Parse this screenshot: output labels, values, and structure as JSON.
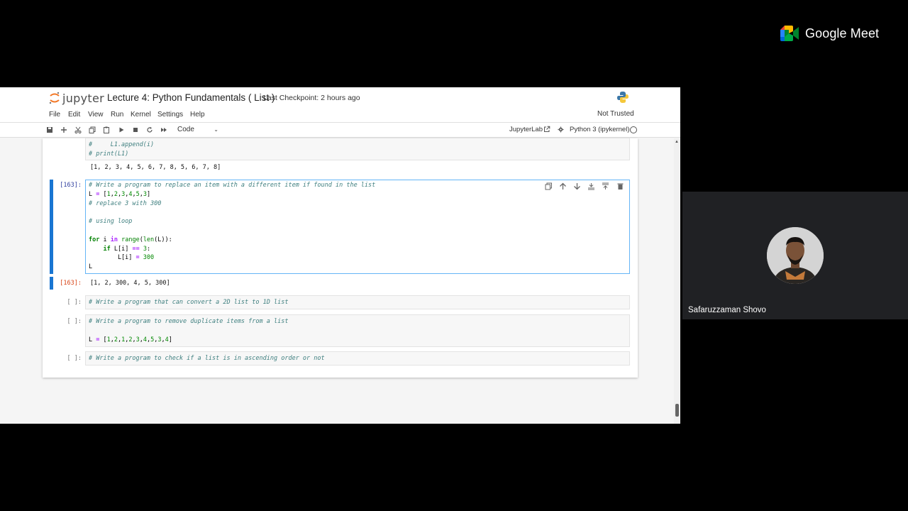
{
  "jupyter": {
    "logo_text": "jupyter",
    "notebook_title": "Lecture 4: Python Fundamentals ( List )",
    "checkpoint": "Last Checkpoint: 2 hours ago",
    "menu": [
      "File",
      "Edit",
      "View",
      "Run",
      "Kernel",
      "Settings",
      "Help"
    ],
    "trust_status": "Not Trusted",
    "toolbar": {
      "cell_type": "Code",
      "jupyterlab_link": "JupyterLab",
      "kernel_name": "Python 3 (ipykernel)"
    },
    "cells": {
      "prev_code_line1": "#     L1.append(i)",
      "prev_code_line2": "# print(L1)",
      "prev_output": "[1, 2, 3, 4, 5, 6, 7, 8, 5, 6, 7, 8]",
      "active_prompt": "[163]:",
      "active_output_prompt": "[163]:",
      "active_output": "[1, 2, 300, 4, 5, 300]",
      "cell2_prompt": "[ ]:",
      "cell2_code": "# Write a program that can convert a 2D list to 1D list",
      "cell3_prompt": "[ ]:",
      "cell3_line1": "# Write a program to remove duplicate items from a list",
      "cell4_prompt": "[ ]:",
      "cell4_code": "# Write a program to check if a list is in ascending order or not"
    }
  },
  "meet": {
    "brand": "Google Meet",
    "participant_name": "Safaruzzaman Shovo"
  }
}
